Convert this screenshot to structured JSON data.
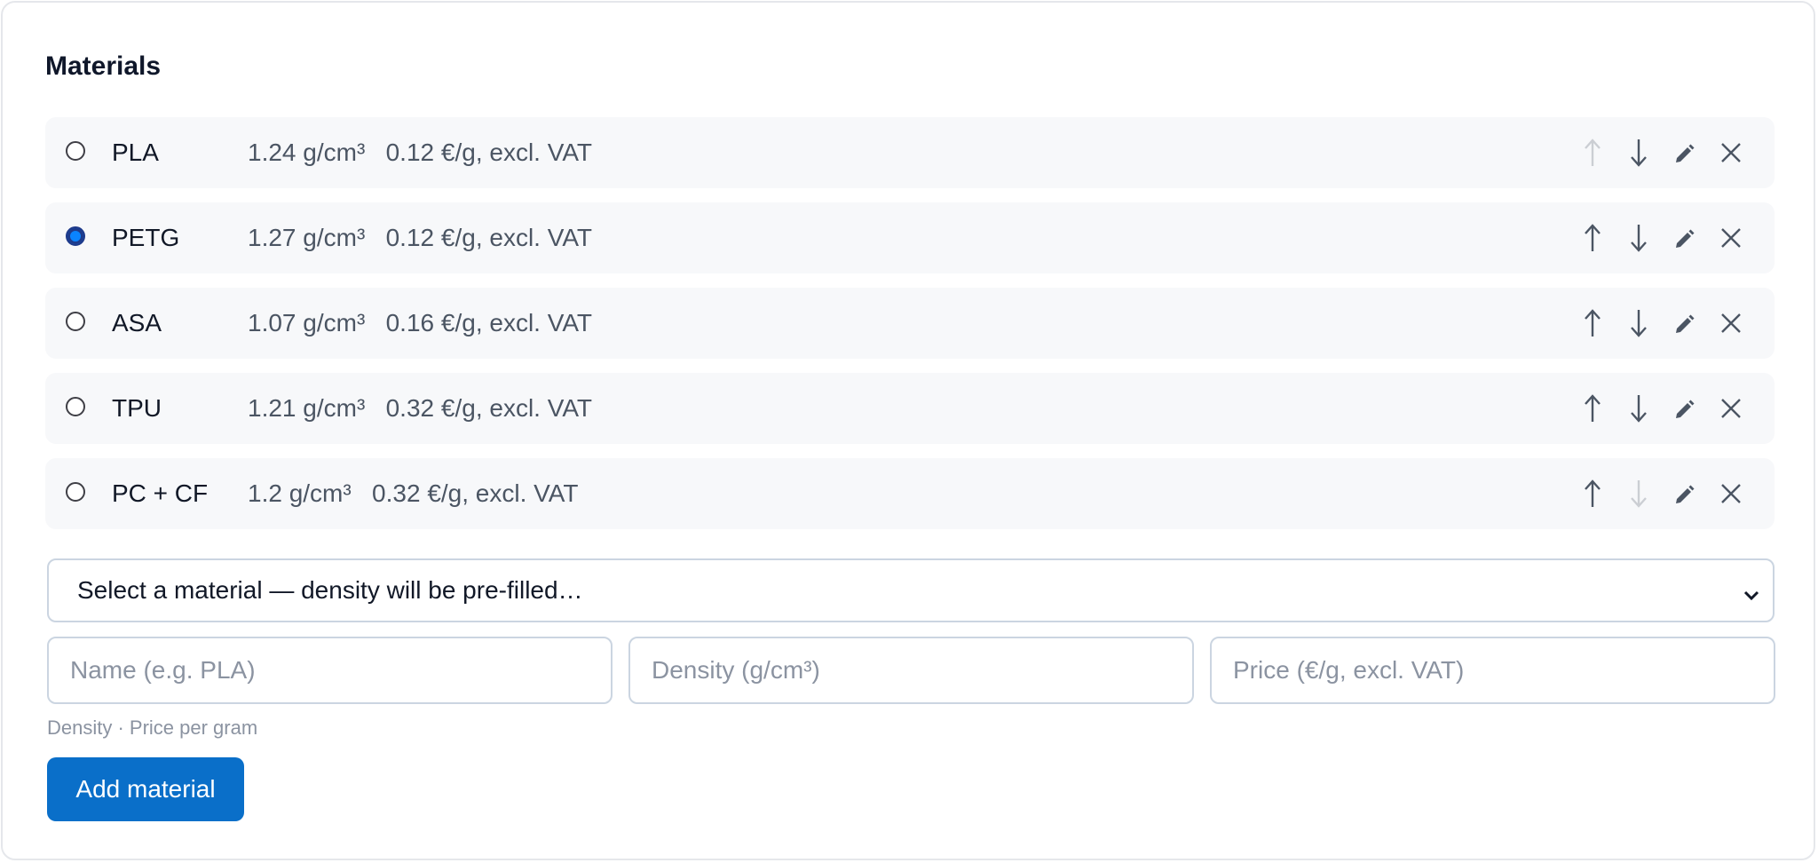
{
  "section": {
    "title": "Materials"
  },
  "materials": [
    {
      "name": "PLA",
      "meta": "1.24 g/cm³   0.12 €/g, excl. VAT",
      "selected": false,
      "up_enabled": false,
      "down_enabled": true
    },
    {
      "name": "PETG",
      "meta": "1.27 g/cm³   0.12 €/g, excl. VAT",
      "selected": true,
      "up_enabled": true,
      "down_enabled": true
    },
    {
      "name": "ASA",
      "meta": "1.07 g/cm³   0.16 €/g, excl. VAT",
      "selected": false,
      "up_enabled": true,
      "down_enabled": true
    },
    {
      "name": "TPU",
      "meta": "1.21 g/cm³   0.32 €/g, excl. VAT",
      "selected": false,
      "up_enabled": true,
      "down_enabled": true
    },
    {
      "name": "PC + CF",
      "meta": "1.2 g/cm³   0.32 €/g, excl. VAT",
      "selected": false,
      "up_enabled": true,
      "down_enabled": false
    }
  ],
  "icons": {
    "move_up": "arrow-up-icon",
    "move_down": "arrow-down-icon",
    "edit": "pencil-icon",
    "delete": "close-icon"
  },
  "preset_select": {
    "value": "Select a material — density will be pre-filled…"
  },
  "form": {
    "name_placeholder": "Name (e.g. PLA)",
    "density_placeholder": "Density (g/cm³)",
    "price_placeholder": "Price (€/g, excl. VAT)",
    "hint": "Density · Price per gram",
    "add_label": "Add material"
  },
  "colors": {
    "accent": "#0a6fc9",
    "row_bg": "#f7f8fa",
    "selected_radio": "#0a84ff"
  }
}
